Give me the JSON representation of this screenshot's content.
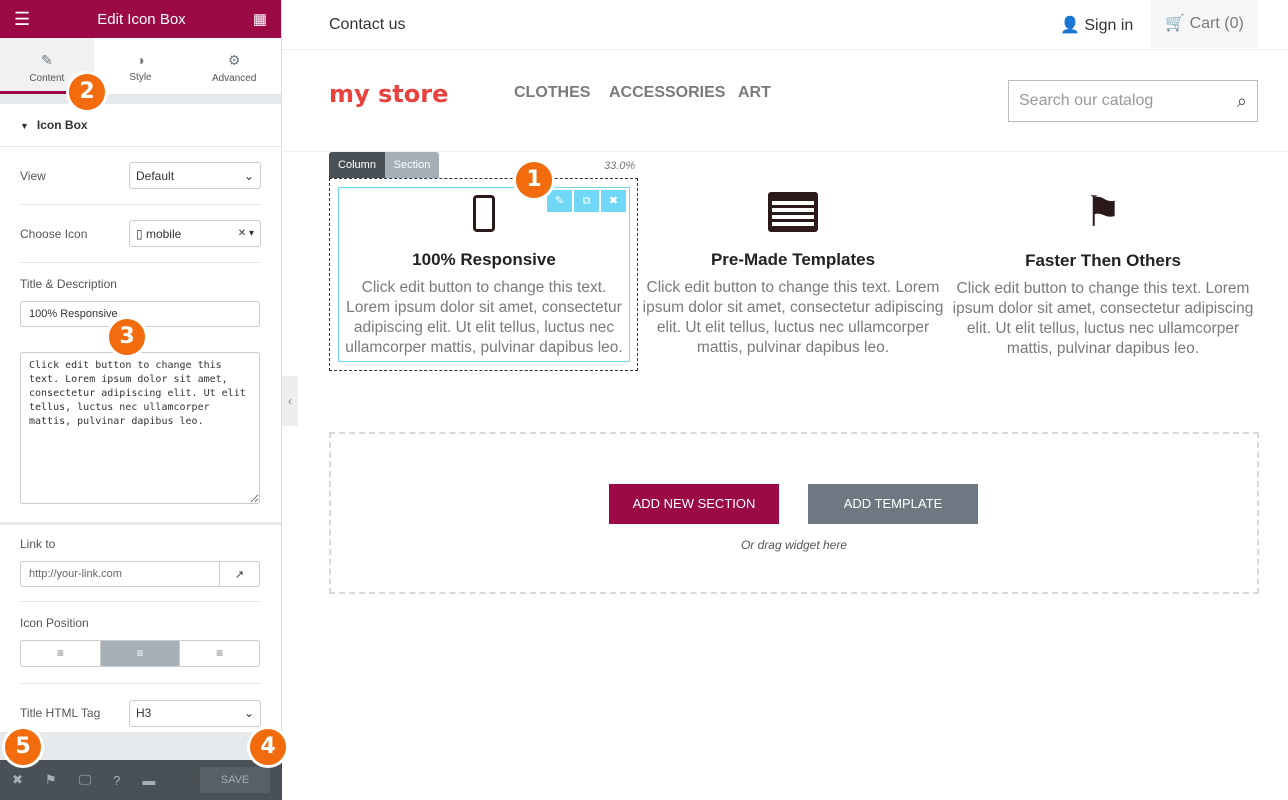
{
  "panel": {
    "title": "Edit Icon Box",
    "tabs": [
      {
        "label": "Content",
        "icon": "pencil-icon"
      },
      {
        "label": "Style",
        "icon": "contrast-icon"
      },
      {
        "label": "Advanced",
        "icon": "gear-icon"
      }
    ],
    "section": "Icon Box",
    "view": {
      "label": "View",
      "value": "Default"
    },
    "choose_icon": {
      "label": "Choose Icon",
      "value": "mobile"
    },
    "title_desc": {
      "label": "Title & Description",
      "title": "100% Responsive",
      "description": "Click edit button to change this text. Lorem ipsum dolor sit amet, consectetur adipiscing elit. Ut elit tellus, luctus nec ullamcorper mattis, pulvinar dapibus leo."
    },
    "link": {
      "label": "Link to",
      "placeholder": "http://your-link.com"
    },
    "icon_position": {
      "label": "Icon Position",
      "selected": "center"
    },
    "title_tag": {
      "label": "Title HTML Tag",
      "value": "H3"
    },
    "save": "SAVE"
  },
  "badges": [
    "1",
    "2",
    "3",
    "4",
    "5"
  ],
  "store": {
    "contact": "Contact us",
    "signin": "Sign in",
    "cart": "Cart (0)",
    "logo": "my store",
    "menu": [
      "CLOTHES",
      "ACCESSORIES",
      "ART"
    ],
    "search_placeholder": "Search our catalog"
  },
  "editor": {
    "column": "Column",
    "section": "Section",
    "width": "33.0%"
  },
  "boxes": [
    {
      "title": "100% Responsive",
      "icon": "mobile-icon",
      "text": "Click edit button to change this text. Lorem ipsum dolor sit amet, consectetur adipiscing elit. Ut elit tellus, luctus nec ullamcorper mattis, pulvinar dapibus leo."
    },
    {
      "title": "Pre-Made Templates",
      "icon": "list-alt-icon",
      "text": "Click edit button to change this text. Lorem ipsum dolor sit amet, consectetur adipiscing elit. Ut elit tellus, luctus nec ullamcorper mattis, pulvinar dapibus leo."
    },
    {
      "title": "Faster Then Others",
      "icon": "flag-icon",
      "text": "Click edit button to change this text. Lorem ipsum dolor sit amet, consectetur adipiscing elit. Ut elit tellus, luctus nec ullamcorper mattis, pulvinar dapibus leo."
    }
  ],
  "dropzone": {
    "add_section": "ADD NEW SECTION",
    "add_template": "ADD TEMPLATE",
    "hint": "Or drag widget here"
  },
  "colors": {
    "brand": "#9b0a46",
    "accent": "#f26b0c",
    "selection": "#71d7f7"
  }
}
